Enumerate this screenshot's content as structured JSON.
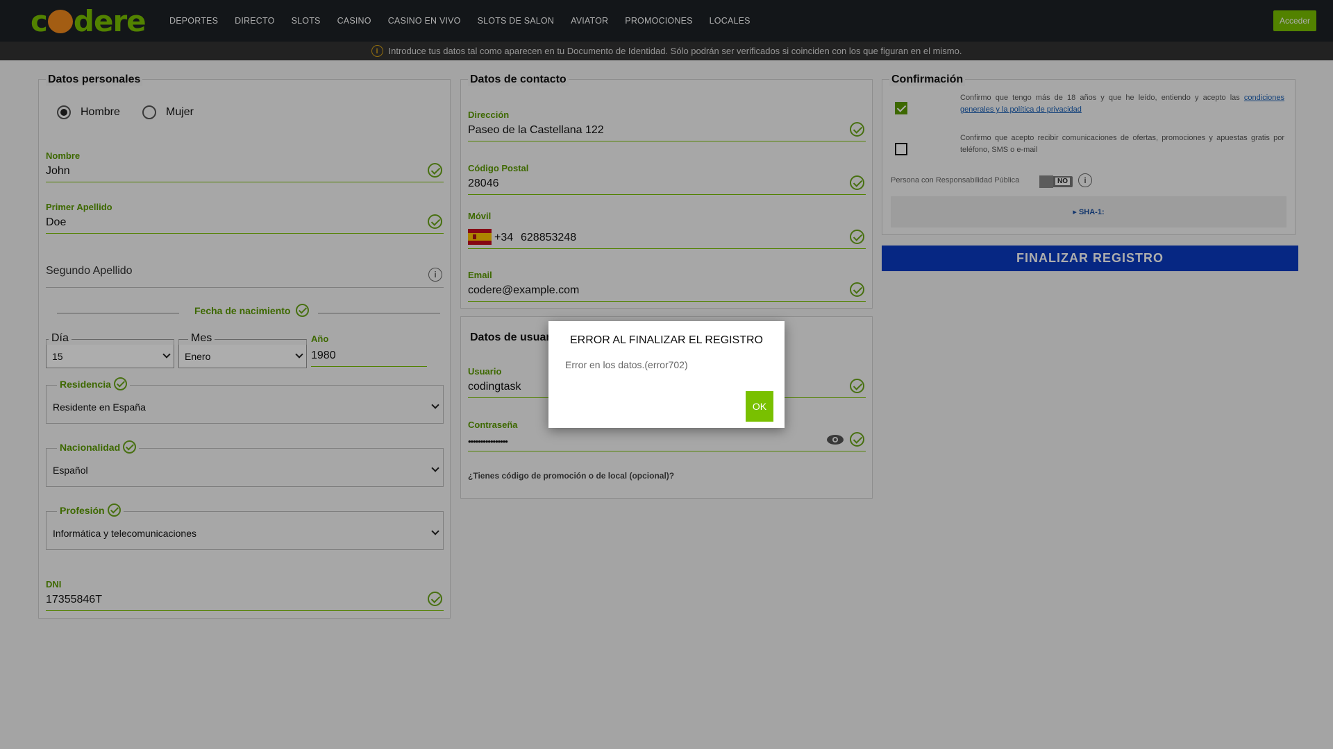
{
  "header": {
    "logo": "codere",
    "nav": [
      "DEPORTES",
      "DIRECTO",
      "SLOTS",
      "CASINO",
      "CASINO EN VIVO",
      "SLOTS DE SALON",
      "AVIATOR",
      "PROMOCIONES",
      "LOCALES"
    ],
    "login_label": "Acceder"
  },
  "infobar": {
    "text": "Introduce tus datos tal como aparecen en tu Documento de Identidad. Sólo podrán ser verificados si coinciden con los que figuran en el mismo."
  },
  "personal": {
    "title": "Datos personales",
    "gender_male": "Hombre",
    "gender_female": "Mujer",
    "gender_selected": "Hombre",
    "nombre_label": "Nombre",
    "nombre_value": "John",
    "apellido1_label": "Primer Apellido",
    "apellido1_value": "Doe",
    "apellido2_placeholder": "Segundo Apellido",
    "fecha_label": "Fecha de nacimiento",
    "dia_label": "Día",
    "dia_value": "15",
    "mes_label": "Mes",
    "mes_value": "Enero",
    "anio_label": "Año",
    "anio_value": "1980",
    "residencia_label": "Residencia",
    "residencia_value": "Residente en España",
    "nacionalidad_label": "Nacionalidad",
    "nacionalidad_value": "Español",
    "profesion_label": "Profesión",
    "profesion_value": "Informática y telecomunicaciones",
    "dni_label": "DNI",
    "dni_value": "17355846T"
  },
  "contact": {
    "title": "Datos de contacto",
    "direccion_label": "Dirección",
    "direccion_value": "Paseo de la Castellana 122",
    "cp_label": "Código Postal",
    "cp_value": "28046",
    "movil_label": "Móvil",
    "movil_prefix": "+34",
    "movil_value": "628853248",
    "email_label": "Email",
    "email_value": "codere@example.com"
  },
  "user": {
    "title": "Datos de usuario",
    "usuario_label": "Usuario",
    "usuario_value": "codingtask",
    "password_label": "Contraseña",
    "password_value": "••••••••••••••••",
    "promo_text": "¿Tienes código de promoción o de local (opcional)?"
  },
  "confirm": {
    "title": "Confirmación",
    "terms_text": "Confirmo que tengo más de 18 años y que he leído, entiendo y acepto las ",
    "terms_link": "condiciones generales y la política de privacidad",
    "terms_checked": true,
    "marketing_text": "Confirmo que acepto recibir comunicaciones de ofertas, promociones y apuestas gratis por teléfono, SMS o e-mail",
    "marketing_checked": false,
    "pep_label": "Persona con Responsabilidad Pública",
    "pep_toggle": "NO",
    "sha_label": "▸ SHA-1:",
    "submit_label": "FINALIZAR REGISTRO"
  },
  "modal": {
    "title": "ERROR AL FINALIZAR EL REGISTRO",
    "message": "Error en los datos.(error702)",
    "ok_label": "OK"
  },
  "colors": {
    "brand_green": "#79c000",
    "submit_blue": "#0a3ac2",
    "topbar": "#1c2126"
  }
}
